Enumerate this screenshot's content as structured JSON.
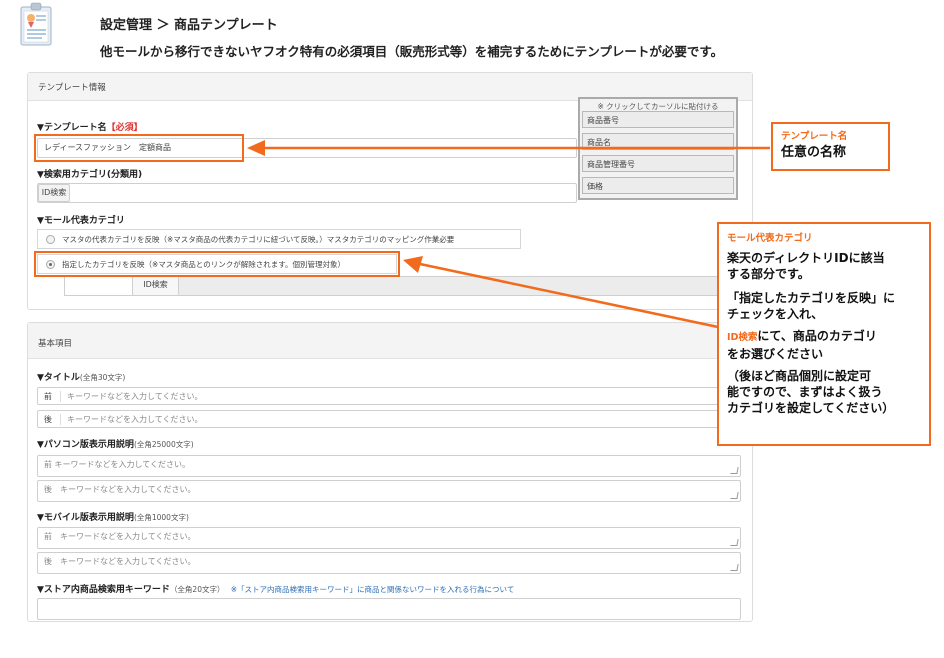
{
  "header": {
    "breadcrumb": "設定管理 ＞ 商品テンプレート",
    "description": "他モールから移行できないヤフオク特有の必須項目（販売形式等）を補完するためにテンプレートが必要です。"
  },
  "template_panel": {
    "title": "テンプレート情報",
    "template_name": {
      "label": "▼テンプレート名",
      "required": "【必須】",
      "value": "レディースファッション　定額商品"
    },
    "search_category": {
      "label": "▼検索用カテゴリ(分類用)",
      "button": "ID検索"
    },
    "mall_category": {
      "label": "▼モール代表カテゴリ",
      "option1": "マスタの代表カテゴリを反映（※マスタ商品の代表カテゴリに紐づいて反映。）マスタカテゴリのマッピング作業必要",
      "option2": "指定したカテゴリを反映（※マスタ商品とのリンクが解除されます。個別管理対象）",
      "button": "ID検索"
    },
    "paste_list": {
      "title": "※ クリックしてカーソルに貼付ける",
      "items": [
        "商品番号",
        "商品名",
        "商品管理番号",
        "価格"
      ]
    }
  },
  "basic_panel": {
    "title": "基本項目",
    "title_field": {
      "label": "▼タイトル",
      "sub": "(全角30文字)",
      "before_prefix": "前",
      "after_prefix": "後",
      "placeholder": "キーワードなどを入力してください。"
    },
    "pc_desc": {
      "label": "▼パソコン版表示用説明",
      "sub": "(全角25000文字)",
      "before_text": "前 キーワードなどを入力してください。",
      "after_text": "後　キーワードなどを入力してください。"
    },
    "mobile_desc": {
      "label": "▼モバイル版表示用説明",
      "sub": "(全角1000文字)",
      "before_text": "前　キーワードなどを入力してください。",
      "after_text": "後　キーワードなどを入力してください。"
    },
    "store_keyword": {
      "label": "▼ストア内商品検索用キーワード",
      "sub": "（全角20文字）",
      "note": "※「ストア内商品検索用キーワード」に商品と関係ないワードを入れる行為について"
    }
  },
  "callouts": {
    "name": {
      "title": "テンプレート名",
      "text": "任意の名称"
    },
    "category": {
      "title": "モール代表カテゴリ",
      "line1": "楽天のディレクトリIDに該当",
      "line2": "する部分です。",
      "line3": "「指定したカテゴリを反映」に",
      "line4": "チェックを入れ、",
      "line5_em": "ID検索",
      "line5_rest": "にて、商品のカテゴリ",
      "line6": "をお選びください",
      "line7": "（後ほど商品個別に設定可",
      "line8": "能ですので、まずはよく扱う",
      "line9": "カテゴリを設定してください）"
    }
  },
  "colors": {
    "accent": "#f26a1b",
    "required": "#dd3333",
    "link": "#2b6db3"
  }
}
